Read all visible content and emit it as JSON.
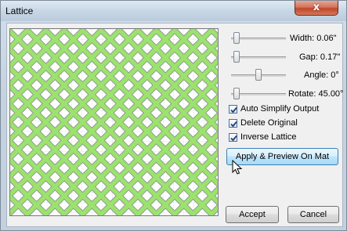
{
  "window": {
    "title": "Lattice",
    "close_glyph": "x"
  },
  "preview": {
    "background_color": "#ffffff",
    "lattice_color": "#9be26e",
    "outline_color": "#8a8a8a",
    "grid_color": "#dde3ea"
  },
  "sliders": [
    {
      "label": "Width: 0.06\"",
      "level": 0.05
    },
    {
      "label": "Gap: 0.17\"",
      "level": 0.05
    },
    {
      "label": "Angle: 0°",
      "level": 0.5
    },
    {
      "label": "Rotate: 45.00°",
      "level": 0.05
    }
  ],
  "options": [
    {
      "label": "Auto Simplify Output",
      "checked": true
    },
    {
      "label": "Delete Original",
      "checked": true
    },
    {
      "label": "Inverse Lattice",
      "checked": true
    }
  ],
  "buttons": {
    "apply_preview": "Apply & Preview On Mat",
    "accept": "Accept",
    "cancel": "Cancel"
  },
  "icons": {
    "close": "close-icon",
    "cursor": "mouse-pointer-icon",
    "check": "checkmark-icon"
  }
}
